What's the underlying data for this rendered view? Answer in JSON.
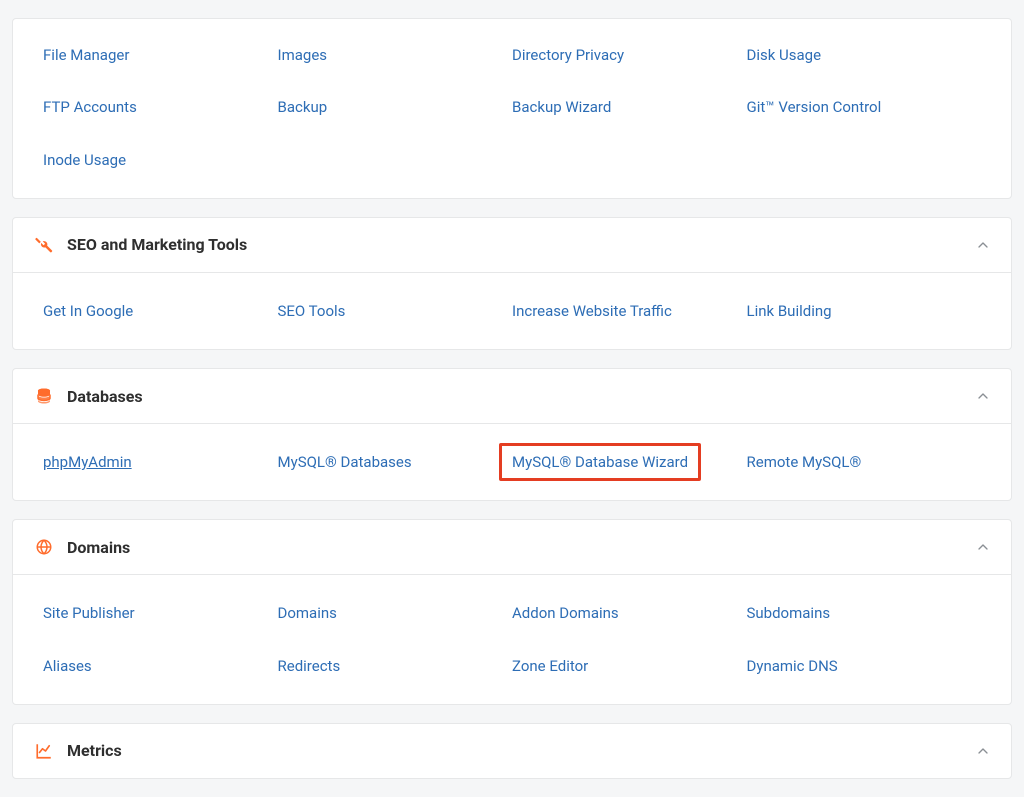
{
  "panels": [
    {
      "id": "files",
      "title": "",
      "icon": "",
      "no_header": true,
      "items": [
        {
          "id": "file-manager",
          "label": "File Manager"
        },
        {
          "id": "images",
          "label": "Images"
        },
        {
          "id": "directory-privacy",
          "label": "Directory Privacy"
        },
        {
          "id": "disk-usage",
          "label": "Disk Usage"
        },
        {
          "id": "ftp-accounts",
          "label": "FTP Accounts"
        },
        {
          "id": "backup",
          "label": "Backup"
        },
        {
          "id": "backup-wizard",
          "label": "Backup Wizard"
        },
        {
          "id": "git-version-control",
          "label": "Git™ Version Control"
        },
        {
          "id": "inode-usage",
          "label": "Inode Usage"
        }
      ]
    },
    {
      "id": "seo",
      "title": "SEO and Marketing Tools",
      "icon": "tools-icon",
      "items": [
        {
          "id": "get-in-google",
          "label": "Get In Google"
        },
        {
          "id": "seo-tools",
          "label": "SEO Tools"
        },
        {
          "id": "increase-website-traffic",
          "label": "Increase Website Traffic"
        },
        {
          "id": "link-building",
          "label": "Link Building"
        }
      ]
    },
    {
      "id": "databases",
      "title": "Databases",
      "icon": "database-icon",
      "items": [
        {
          "id": "phpmyadmin",
          "label": "phpMyAdmin",
          "underlined": true
        },
        {
          "id": "mysql-databases",
          "label": "MySQL® Databases"
        },
        {
          "id": "mysql-database-wizard",
          "label": "MySQL® Database Wizard",
          "highlighted": true
        },
        {
          "id": "remote-mysql",
          "label": "Remote MySQL®"
        }
      ]
    },
    {
      "id": "domains",
      "title": "Domains",
      "icon": "globe-icon",
      "items": [
        {
          "id": "site-publisher",
          "label": "Site Publisher"
        },
        {
          "id": "domains-link",
          "label": "Domains"
        },
        {
          "id": "addon-domains",
          "label": "Addon Domains"
        },
        {
          "id": "subdomains",
          "label": "Subdomains"
        },
        {
          "id": "aliases",
          "label": "Aliases"
        },
        {
          "id": "redirects",
          "label": "Redirects"
        },
        {
          "id": "zone-editor",
          "label": "Zone Editor"
        },
        {
          "id": "dynamic-dns",
          "label": "Dynamic DNS"
        }
      ]
    },
    {
      "id": "metrics",
      "title": "Metrics",
      "icon": "metrics-icon",
      "items": []
    }
  ],
  "colors": {
    "link": "#2d6db5",
    "accent": "#ff6c2c",
    "highlight_border": "#e43d22"
  }
}
